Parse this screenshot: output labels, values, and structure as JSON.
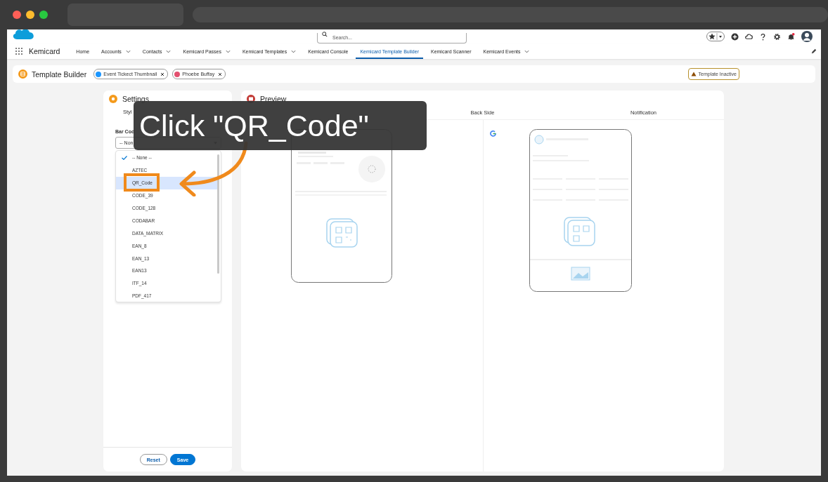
{
  "app": {
    "name": "Kemicard"
  },
  "search": {
    "placeholder": "Search..."
  },
  "nav_items": [
    {
      "label": "Home",
      "has_menu": false,
      "selected": false
    },
    {
      "label": "Accounts",
      "has_menu": true,
      "selected": false
    },
    {
      "label": "Contacts",
      "has_menu": true,
      "selected": false
    },
    {
      "label": "Kemicard Passes",
      "has_menu": true,
      "selected": false
    },
    {
      "label": "Kemicard Templates",
      "has_menu": true,
      "selected": false
    },
    {
      "label": "Kemicard Console",
      "has_menu": false,
      "selected": false
    },
    {
      "label": "Kemicard Template Builder",
      "has_menu": false,
      "selected": true
    },
    {
      "label": "Kemicard Scanner",
      "has_menu": false,
      "selected": false
    },
    {
      "label": "Kemicard Events",
      "has_menu": true,
      "selected": false
    }
  ],
  "page_header": {
    "title": "Template Builder",
    "chips": [
      {
        "label": "Event Tickect Thumbnail",
        "color": "#1b96ff"
      },
      {
        "label": "Phoebe Buffay",
        "color": "#e3506f"
      }
    ],
    "status": "Template Inactive"
  },
  "settings": {
    "title": "Settings",
    "tab": "Styl",
    "field_label": "Bar Cod",
    "value": "-- Non",
    "options": [
      {
        "label": "-- None --",
        "checked": true,
        "highlighted": false
      },
      {
        "label": "AZTEC",
        "checked": false,
        "highlighted": false
      },
      {
        "label": "QR_Code",
        "checked": false,
        "highlighted": true
      },
      {
        "label": "CODE_39",
        "checked": false,
        "highlighted": false
      },
      {
        "label": "CODE_128",
        "checked": false,
        "highlighted": false
      },
      {
        "label": "CODABAR",
        "checked": false,
        "highlighted": false
      },
      {
        "label": "DATA_MATRIX",
        "checked": false,
        "highlighted": false
      },
      {
        "label": "EAN_8",
        "checked": false,
        "highlighted": false
      },
      {
        "label": "EAN_13",
        "checked": false,
        "highlighted": false
      },
      {
        "label": "EAN13",
        "checked": false,
        "highlighted": false
      },
      {
        "label": "ITF_14",
        "checked": false,
        "highlighted": false
      },
      {
        "label": "PDF_417",
        "checked": false,
        "highlighted": false
      }
    ],
    "buttons": [
      {
        "label": "Reset",
        "kind": "neutral"
      },
      {
        "label": "Save",
        "kind": "brand"
      }
    ]
  },
  "preview": {
    "title": "Preview",
    "tabs": [
      {
        "label": "Back Side",
        "selected": false
      },
      {
        "label": "Notification",
        "selected": false
      }
    ]
  },
  "callout": {
    "text": "Click \"QR_Code\""
  }
}
